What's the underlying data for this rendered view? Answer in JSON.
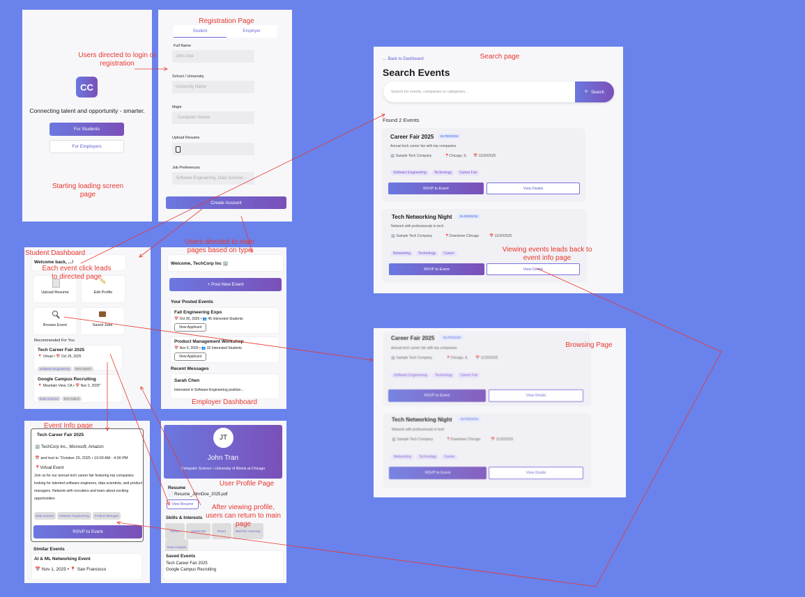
{
  "notes": {
    "login": "Users directed to login  or registration",
    "starting": "Starting loading screen page",
    "registration": "Registration Page",
    "search": "Search page",
    "student_dash": "Student Dashboard",
    "event_click": "Each event click leads to directed page",
    "main_pages": "Users directed to main pages based on type",
    "viewing": "Viewing events leads back to event info page",
    "browsing": "Browsing Page",
    "employer_dash": "Employer Dashboard",
    "event_info": "Event Info page",
    "user_profile": "User Profile Page",
    "after_profile": "After viewing profile, users can return to main page"
  },
  "landing": {
    "logo": "CC",
    "tagline": "Connecting talent and opportunity - smarter.",
    "students_btn": "For Students",
    "employers_btn": "For Employers"
  },
  "registration": {
    "tab_student": "Student",
    "tab_employer": "Employer",
    "full_name_label": "Full Name",
    "full_name_ph": "John Doe",
    "school_label": "School / University",
    "school_ph": "University Name",
    "major_label": "Major",
    "major_ph": "Computer Sceine",
    "resume_label": "Upload Resume",
    "prefs_label": "Job Preferences",
    "prefs_ph": "Software Engineering, Data Science...",
    "create_btn": "Create Account"
  },
  "search": {
    "back": "← Back to Dashboard",
    "title": "Search Events",
    "placeholder": "Search for events, companies or categories...",
    "search_btn": "🔍 Search",
    "found": "Found 2 Events"
  },
  "events": [
    {
      "title": "Career Fair 2025",
      "badge": "IN-PERSON",
      "desc": "Annual tech career fair with top companies",
      "company": "🏢 Sample Tech Company",
      "location": "📍Chicago, IL",
      "date": "📅 11/20/2025",
      "tags": [
        "Software Engineering",
        "Technology",
        "Career Fair"
      ],
      "rsvp": "RSVP to Event",
      "details": "View Deails"
    },
    {
      "title": "Tech Networking Night",
      "badge": "IN-PERSON",
      "desc": "Network with professionals in tech",
      "company": "🏢 Sample Tech Company",
      "location": "📍Downtown Chicago",
      "date": "📅 11/20/2025",
      "tags": [
        "Networking",
        "Technology",
        "Career"
      ],
      "rsvp": "RSVP to Event",
      "details": "View Deails"
    }
  ],
  "student": {
    "welcome": "Welcome back, ...!",
    "upload": "Upload Resume",
    "edit": "Edit Profile",
    "browse": "Browse Event",
    "saved": "Saved Jobs",
    "recommended": "Recommended For You",
    "rec1_title": "Tech Career Fair 2025",
    "rec1_meta": "📍 Virtual • 📅 Oct 25, 2025",
    "rec1_tag1": "Software Engineering",
    "rec1_tag2": "95% Match",
    "rec2_title": "Google Campus Recruiting",
    "rec2_meta": "📍 Mountain View, CA • 📅 Nov 2, 2025\"",
    "rec2_tag1": "Data Science",
    "rec2_tag2": "82% Match"
  },
  "employer": {
    "welcome": "Welcome, TechCorp Inc 🏢",
    "post_btn": "+ Post New Event",
    "posted": "Your Posted Events",
    "ev1_title": "Fall Engineering Expo",
    "ev1_meta": "📅 Oct 30, 2025 • 👥 45 Interested Students",
    "ev2_title": "Product Management Workshop",
    "ev2_meta": "📅 Nov 5, 2025 • 👥 32 Interested Students",
    "view_applicant": "View Applicant",
    "messages": "Recent Messages",
    "msg_name": "Sarah Chen",
    "msg_text": "Interested in Software Engineering position..."
  },
  "event_info": {
    "title": "Tech Career Fair 2025",
    "companies": "🏢 TechCorp Inc., Microsoft, Amazon",
    "date": "📅 and text to \"October 25, 2025 • 10:00 AM - 4:00 PM",
    "venue": "📍Virtual Event",
    "desc": "Join us for our annual tech career fair featuring top companies looking for talented software engineers, data scientists, and product managers. Network with recruiters and learn about exciting opportunities",
    "tags": [
      "Data Science",
      "Software Engineering",
      "Product Manager"
    ],
    "rsvp": "RSVP to Event",
    "similar": "Similar Events",
    "sim_title": "AI & ML Networking Event",
    "sim_meta": "📅 Nov 1, 2025 • 📍 San Francisco"
  },
  "profile": {
    "initials": "JT",
    "name": "John Tran",
    "subtitle": "Computer Science • University of Illinois at Chicago",
    "resume_h": "Resume",
    "resume_file": "📄 Resume_JohnDoe_2025.pdf",
    "view_resume": "View Resume",
    "skills_h": "Skills & Interests",
    "skills": [
      "Python",
      "JavaScript",
      "React",
      "Machine Learning",
      "Data Analysis"
    ],
    "saved_h": "Saved Events",
    "saved1": "Tech Career Fair 2025",
    "saved2": "Google Campus Recruiting"
  },
  "colors": {
    "background": "#6a82ec",
    "annotation": "#e8362d",
    "accent": "#7a50b8"
  }
}
